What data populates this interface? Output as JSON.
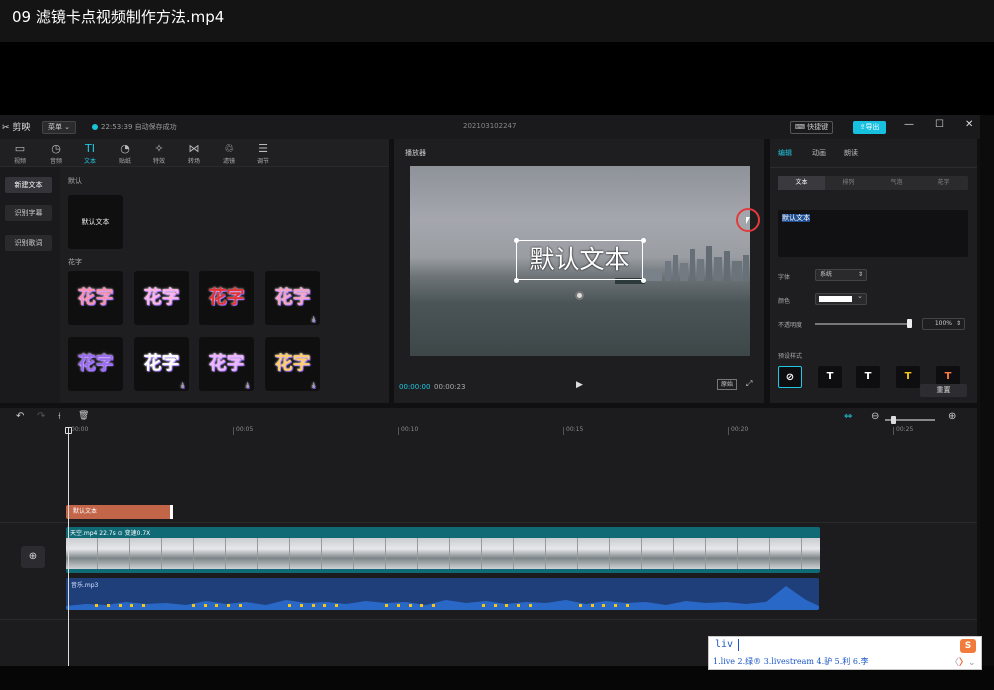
{
  "video_title": "09  滤镜卡点视频制作方法.mp4",
  "titlebar": {
    "app_name": "剪映",
    "menu_label": "菜单",
    "save_status": "22:53:39 自动保存成功",
    "project_name": "202103102247",
    "shortcut_label": "快捷键",
    "export_label": "导出",
    "minimize": "—",
    "maximize": "☐",
    "close": "✕"
  },
  "left_panel": {
    "tools": [
      {
        "icon": "▭",
        "label": "视频"
      },
      {
        "icon": "◷",
        "label": "音频"
      },
      {
        "icon": "TI",
        "label": "文本"
      },
      {
        "icon": "◔",
        "label": "贴纸"
      },
      {
        "icon": "✧",
        "label": "特效"
      },
      {
        "icon": "⋈",
        "label": "转场"
      },
      {
        "icon": "♲",
        "label": "滤镜"
      },
      {
        "icon": "☰",
        "label": "调节"
      }
    ],
    "side_buttons": [
      "新建文本",
      "识别字幕",
      "识别歌词"
    ],
    "default_section": "默认",
    "default_tile_text": "默认文本",
    "flower_section": "花字",
    "flower_text": "花字",
    "flower_tiles": [
      {
        "color": "#ff8fb1",
        "download": false
      },
      {
        "color": "#ffb3e6",
        "download": false
      },
      {
        "color": "#e83232",
        "download": false
      },
      {
        "color": "#f5a3c7",
        "download": true
      },
      {
        "color": "#9b6cf0",
        "download": false
      },
      {
        "color": "#ffffff",
        "download": true
      },
      {
        "color": "#f0b4ff",
        "download": true
      },
      {
        "color": "#ffcf6b",
        "download": true
      }
    ],
    "download_icon": "⤓"
  },
  "player": {
    "label": "播放器",
    "caption_text": "默认文本",
    "time_current": "00:00:00",
    "time_total": "00:00:23",
    "play_icon": "▶",
    "ratio_label": "原始",
    "fullscreen_icon": "⤢",
    "rotate_icon": "⊗"
  },
  "properties": {
    "tabs": [
      "编辑",
      "动画",
      "朗读"
    ],
    "subtabs": [
      "文本",
      "排列",
      "气泡",
      "花字"
    ],
    "text_value": "默认文本",
    "font_label": "字体",
    "font_value": "系统",
    "color_label": "颜色",
    "opacity_label": "不透明度",
    "opacity_value": "100%",
    "opacity_level": 1.0,
    "preset_label": "预设样式",
    "preset_colors": [
      "#ffffff",
      "#ffffff",
      "#f5c518",
      "#ff7a45"
    ],
    "reset_label": "重置",
    "chevron": "⌄"
  },
  "timeline": {
    "toolbar_icons": [
      "↶",
      "↷",
      "⟊",
      "🗑"
    ],
    "ruler_ticks": [
      "00:00",
      "00:05",
      "00:10",
      "00:15",
      "00:20",
      "00:25"
    ],
    "text_clip_label": "默认文本",
    "video_track_label": "天空.mp4   22.7s   ⊙ 变速0.7X",
    "audio_track_label": "音乐.mp3",
    "cover_icon": "⊕",
    "zoom_minus": "⊖",
    "zoom_plus": "⊕",
    "link_icon": "⇔"
  },
  "ime": {
    "input": "liv",
    "candidates": "1.live  2.绿®  3.livestream  4.驴  5.利  6.李",
    "logo": "S",
    "prev": "〈",
    "next": "〉",
    "more": "⌄"
  }
}
